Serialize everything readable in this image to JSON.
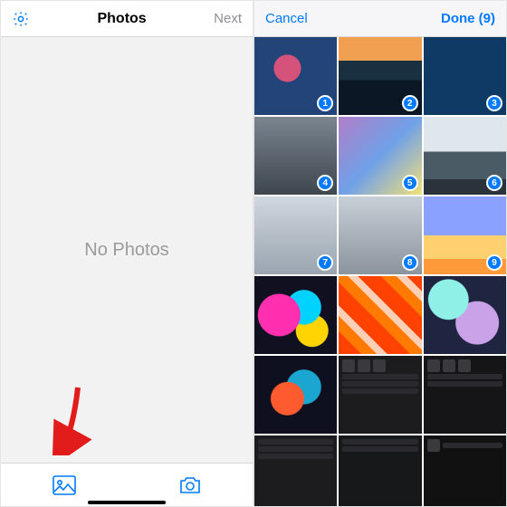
{
  "left": {
    "title": "Photos",
    "next": "Next",
    "empty_text": "No Photos"
  },
  "right": {
    "cancel": "Cancel",
    "done": "Done (9)",
    "badges": [
      "1",
      "2",
      "3",
      "4",
      "5",
      "6",
      "7",
      "8",
      "9"
    ]
  },
  "colors": {
    "ios_blue": "#007aff"
  }
}
